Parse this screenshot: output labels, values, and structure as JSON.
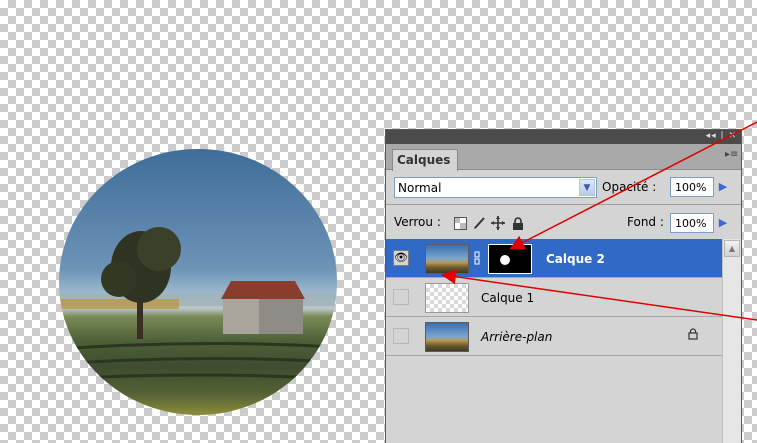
{
  "panel": {
    "tab_label": "Calques",
    "title_controls": "◂◂ | ✕",
    "blend_mode": "Normal",
    "opacity_label": "Opacité :",
    "opacity_value": "100%",
    "lock_label": "Verrou :",
    "fill_label": "Fond :",
    "fill_value": "100%"
  },
  "layers": [
    {
      "name": "Calque 2",
      "selected": true,
      "visible": true,
      "has_mask": true
    },
    {
      "name": "Calque 1",
      "selected": false,
      "visible": false,
      "has_mask": false
    },
    {
      "name": "Arrière-plan",
      "selected": false,
      "visible": false,
      "has_mask": false,
      "locked": true
    }
  ],
  "colors": {
    "selection": "#3169c6",
    "annotation_arrow": "#e00000",
    "panel_bg": "#d4d4d4"
  }
}
